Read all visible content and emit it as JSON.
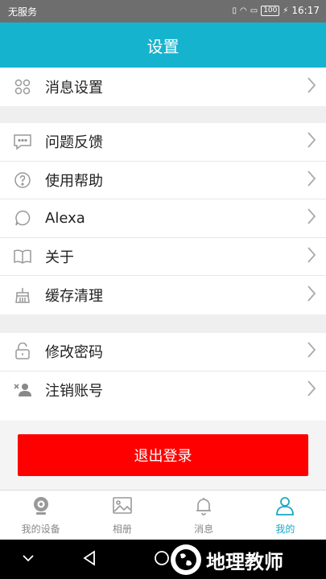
{
  "status_bar": {
    "carrier": "无服务",
    "battery": "100",
    "time": "16:17"
  },
  "header": {
    "title": "设置"
  },
  "groups": [
    {
      "items": [
        {
          "label": "消息设置",
          "icon": "grid-icon"
        }
      ]
    },
    {
      "items": [
        {
          "label": "问题反馈",
          "icon": "chat-bubble-icon"
        },
        {
          "label": "使用帮助",
          "icon": "help-circle-icon"
        },
        {
          "label": "Alexa",
          "icon": "speech-icon"
        },
        {
          "label": "关于",
          "icon": "book-icon"
        },
        {
          "label": "缓存清理",
          "icon": "broom-icon"
        }
      ]
    },
    {
      "items": [
        {
          "label": "修改密码",
          "icon": "lock-icon"
        },
        {
          "label": "注销账号",
          "icon": "remove-user-icon"
        }
      ]
    }
  ],
  "logout": {
    "label": "退出登录"
  },
  "tabs": [
    {
      "label": "我的设备",
      "icon": "camera-icon",
      "active": false
    },
    {
      "label": "相册",
      "icon": "image-icon",
      "active": false
    },
    {
      "label": "消息",
      "icon": "bell-icon",
      "active": false
    },
    {
      "label": "我的",
      "icon": "person-icon",
      "active": true
    }
  ],
  "watermark": {
    "text": "地理教师"
  },
  "colors": {
    "accent": "#16b3cf",
    "danger": "#ff0000",
    "active_tab": "#1aa7c4"
  }
}
